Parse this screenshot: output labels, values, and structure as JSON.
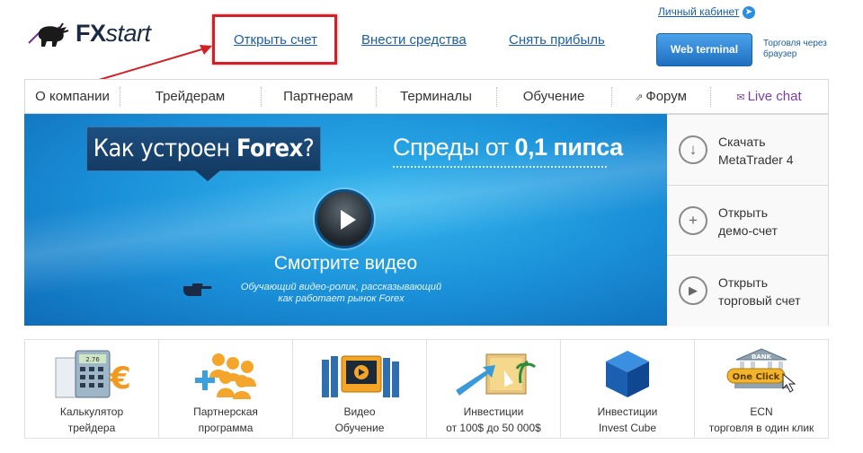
{
  "header": {
    "logo_fx": "FX",
    "logo_start": "start",
    "links": {
      "open_account": "Открыть счет",
      "deposit": "Внести средства",
      "withdraw": "Снять прибыль"
    },
    "cabinet": "Личный кабинет",
    "web_terminal": "Web terminal",
    "web_terminal_note_1": "Торговля через",
    "web_terminal_note_2": "браузер"
  },
  "nav": {
    "items": [
      "О компании",
      "Трейдерам",
      "Партнерам",
      "Терминалы",
      "Обучение",
      "Форум",
      "Live chat"
    ]
  },
  "banner": {
    "forex_prefix": "Как устроен ",
    "forex_bold": "Forex",
    "forex_suffix": "?",
    "spreads_prefix": "Спреды от ",
    "spreads_bold": "0,1 пипса",
    "watch": "Смотрите видео",
    "desc_1": "Обучающий видео-ролик, рассказывающий",
    "desc_2": "как работает рынок Forex"
  },
  "side": [
    {
      "line1": "Скачать",
      "line2": "MetaTrader 4",
      "icon": "download-icon"
    },
    {
      "line1": "Открыть",
      "line2": "демо-счет",
      "icon": "plus-icon"
    },
    {
      "line1": "Открыть",
      "line2": "торговый счет",
      "icon": "play-icon"
    }
  ],
  "tiles": [
    {
      "line1": "Калькулятор",
      "line2": "трейдера",
      "icon": "calculator-icon"
    },
    {
      "line1": "Партнерская",
      "line2": "программа",
      "icon": "partners-icon"
    },
    {
      "line1": "Видео",
      "line2": "Обучение",
      "icon": "video-icon"
    },
    {
      "line1": "Инвестиции",
      "line2": "от 100$ до 50 000$",
      "icon": "investment-icon"
    },
    {
      "line1": "Инвестиции",
      "line2": "Invest Cube",
      "icon": "cube-icon"
    },
    {
      "line1": "ECN",
      "line2": "торговля в один клик",
      "icon": "bank-icon"
    }
  ],
  "icon_text": {
    "calc_display": "2.76",
    "bank": "BANK",
    "one_click": "One Click"
  },
  "colors": {
    "link": "#1a5fa8",
    "highlight": "#d32027",
    "banner": "#1a8fd8",
    "live_chat": "#7b3f9c"
  }
}
